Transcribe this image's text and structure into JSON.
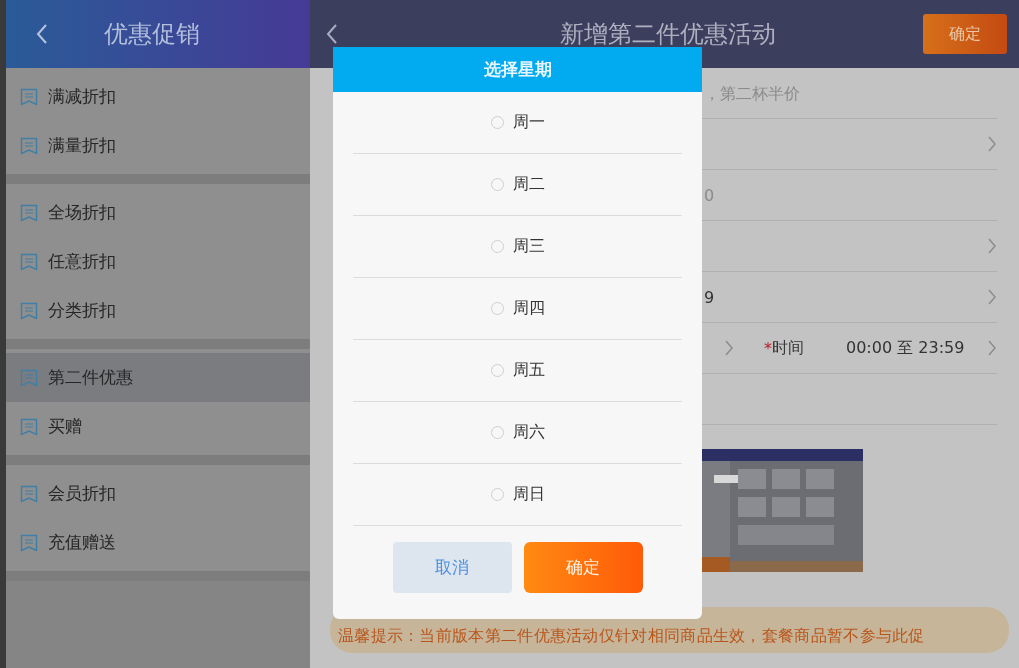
{
  "sidebar": {
    "title": "优惠促销",
    "groups": [
      [
        {
          "label": "满减折扣",
          "selected": false
        },
        {
          "label": "满量折扣",
          "selected": false
        }
      ],
      [
        {
          "label": "全场折扣",
          "selected": false
        },
        {
          "label": "任意折扣",
          "selected": false
        },
        {
          "label": "分类折扣",
          "selected": false
        }
      ],
      [
        {
          "label": "第二件优惠",
          "selected": true
        },
        {
          "label": "买赠",
          "selected": false
        }
      ],
      [
        {
          "label": "会员折扣",
          "selected": false
        },
        {
          "label": "充值赠送",
          "selected": false
        }
      ]
    ]
  },
  "main": {
    "title": "新增第二件优惠活动",
    "confirm": "确定",
    "rows": [
      {
        "kind": "text",
        "placeholder": "，第二杯半价"
      },
      {
        "kind": "link"
      },
      {
        "kind": "text",
        "placeholder": "0"
      },
      {
        "kind": "link"
      },
      {
        "kind": "link",
        "value": "9"
      },
      {
        "kind": "time",
        "required_mark": "*",
        "label": "时间",
        "value": "00:00 至 23:59"
      },
      {
        "kind": "empty"
      }
    ],
    "tip": "温馨提示：当前版本第二件优惠活动仅针对相同商品生效，套餐商品暂不参与此促"
  },
  "dialog": {
    "title": "选择星期",
    "options": [
      {
        "label": "周一",
        "selected": false
      },
      {
        "label": "周二",
        "selected": false
      },
      {
        "label": "周三",
        "selected": false
      },
      {
        "label": "周四",
        "selected": false
      },
      {
        "label": "周五",
        "selected": false
      },
      {
        "label": "周六",
        "selected": false
      },
      {
        "label": "周日",
        "selected": false
      }
    ],
    "cancel": "取消",
    "confirm": "确定"
  }
}
